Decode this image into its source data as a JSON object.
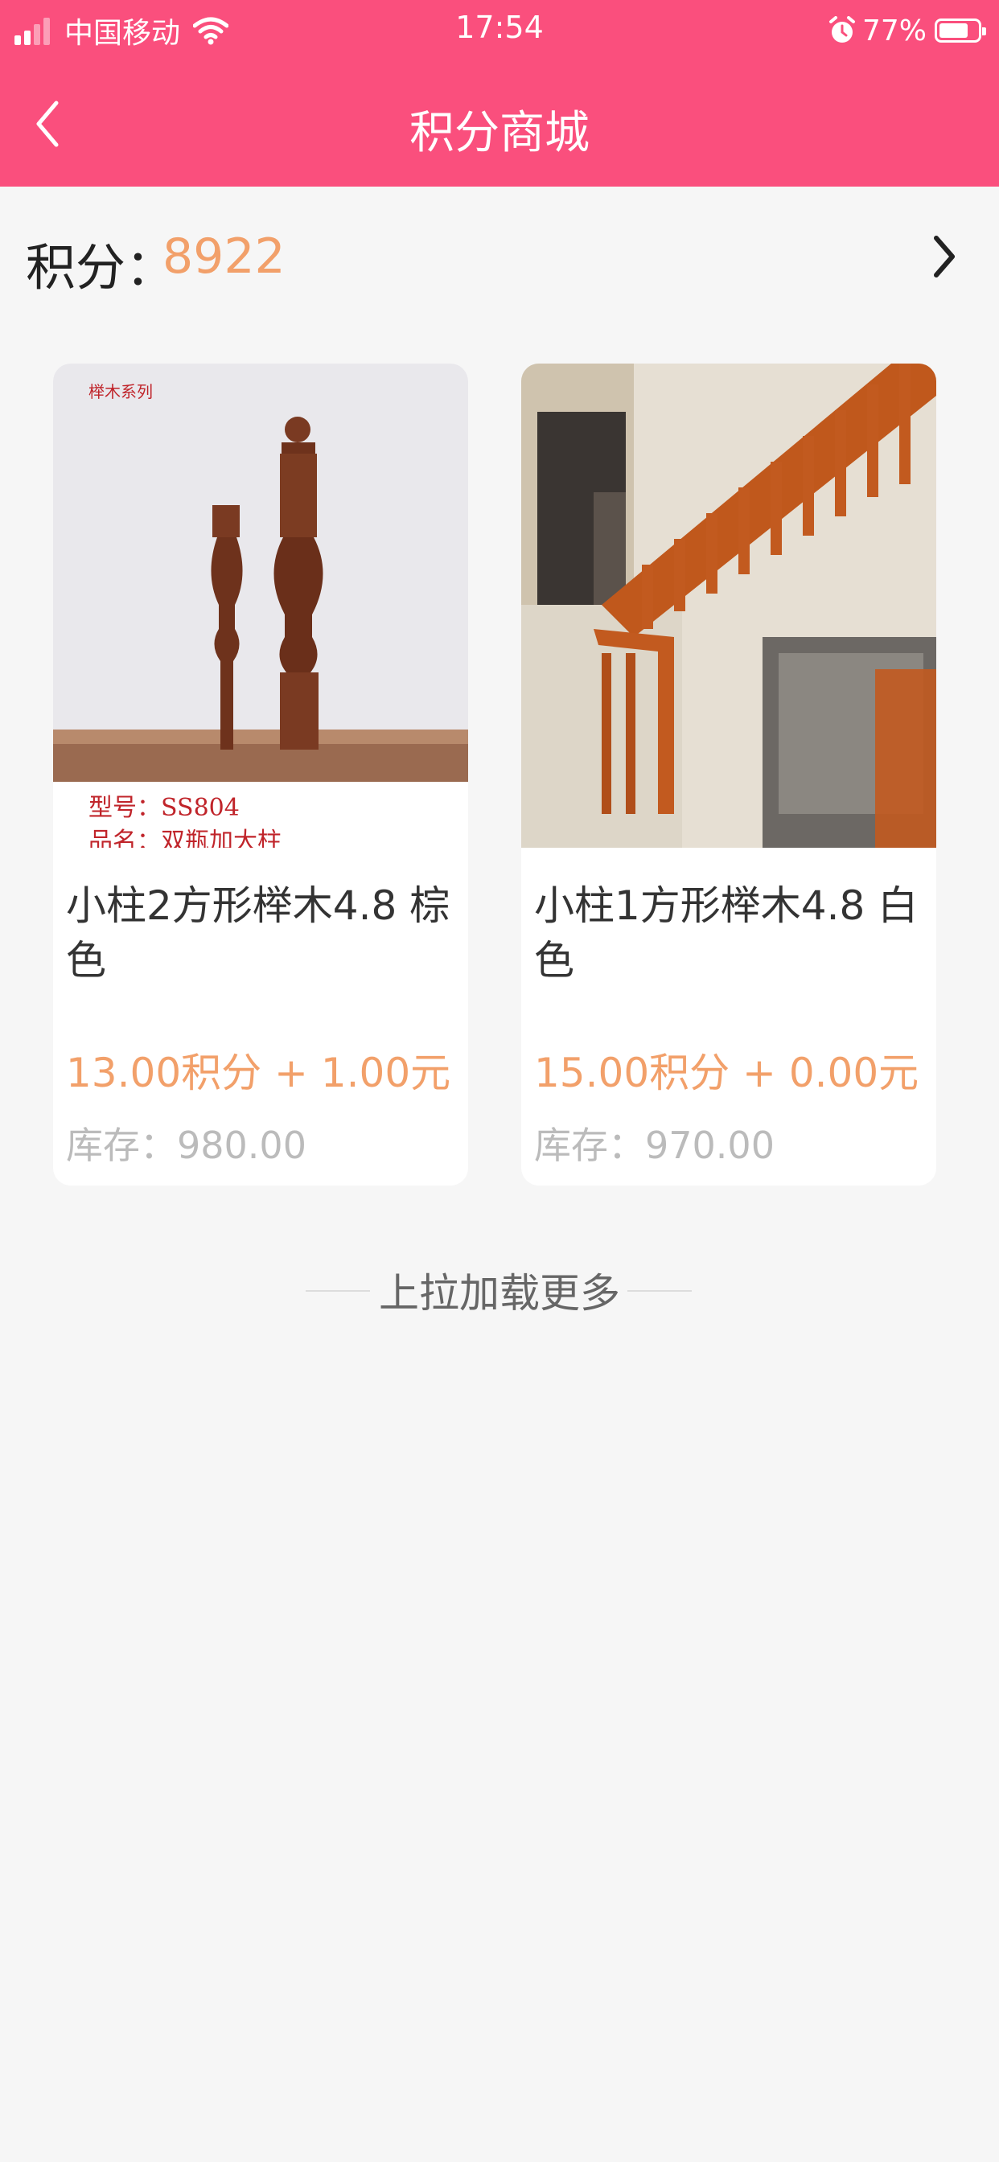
{
  "status_bar": {
    "carrier": "中国移动",
    "time": "17:54",
    "battery_percent": "77%",
    "battery_level": 0.77,
    "icons": [
      "signal-icon",
      "wifi-icon",
      "alarm-icon",
      "battery-icon"
    ]
  },
  "nav": {
    "title": "积分商城",
    "back_icon": "chevron-left-icon"
  },
  "points": {
    "label": "积分：",
    "value": "8922",
    "arrow_icon": "chevron-right-icon"
  },
  "products": [
    {
      "name": "小柱2方形榉木4.8 棕色",
      "price": "13.00积分 + 1.00元",
      "stock": "库存：980.00",
      "image_text": {
        "series": "榉木系列",
        "model": "型号：SS804",
        "item": "品名：双瓶加大柱"
      }
    },
    {
      "name": "小柱1方形榉木4.8 白色",
      "price": "15.00积分 + 0.00元",
      "stock": "库存：970.00"
    }
  ],
  "footer": {
    "load_more": "上拉加载更多"
  },
  "colors": {
    "brand": "#fa4f7d",
    "price": "#f2a06a",
    "background": "#f6f6f6"
  }
}
